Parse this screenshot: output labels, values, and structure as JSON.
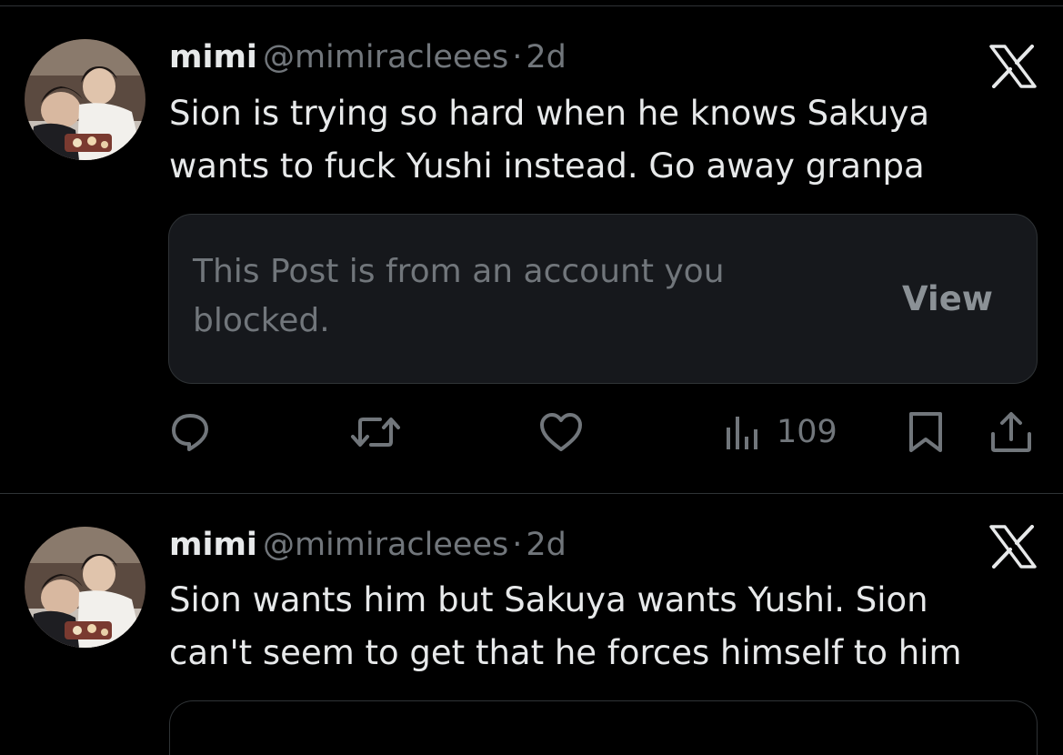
{
  "colors": {
    "background": "#000000",
    "text_primary": "#e7e9ea",
    "text_secondary": "#71767b",
    "divider": "#2f3336",
    "card_background": "#16181c"
  },
  "posts": [
    {
      "display_name": "mimi",
      "handle": "@mimiracleees",
      "separator": "·",
      "time": "2d",
      "text": "Sion is trying so hard when he knows Sakuya\nwants to fuck Yushi instead. Go away granpa",
      "avatar_icon": "avatar-photo",
      "menu_icon": "x-logo-icon",
      "quoted_card": {
        "message": "This Post is from an account you blocked.",
        "button_label": "View"
      },
      "actions": {
        "reply_icon": "reply-icon",
        "repost_icon": "repost-icon",
        "like_icon": "heart-icon",
        "views_icon": "views-chart-icon",
        "views_count": "109",
        "bookmark_icon": "bookmark-icon",
        "share_icon": "share-icon"
      }
    },
    {
      "display_name": "mimi",
      "handle": "@mimiracleees",
      "separator": "·",
      "time": "2d",
      "text": "Sion wants him but Sakuya wants Yushi. Sion\ncan't seem to get that he forces himself to him",
      "avatar_icon": "avatar-photo",
      "menu_icon": "x-logo-icon"
    }
  ]
}
